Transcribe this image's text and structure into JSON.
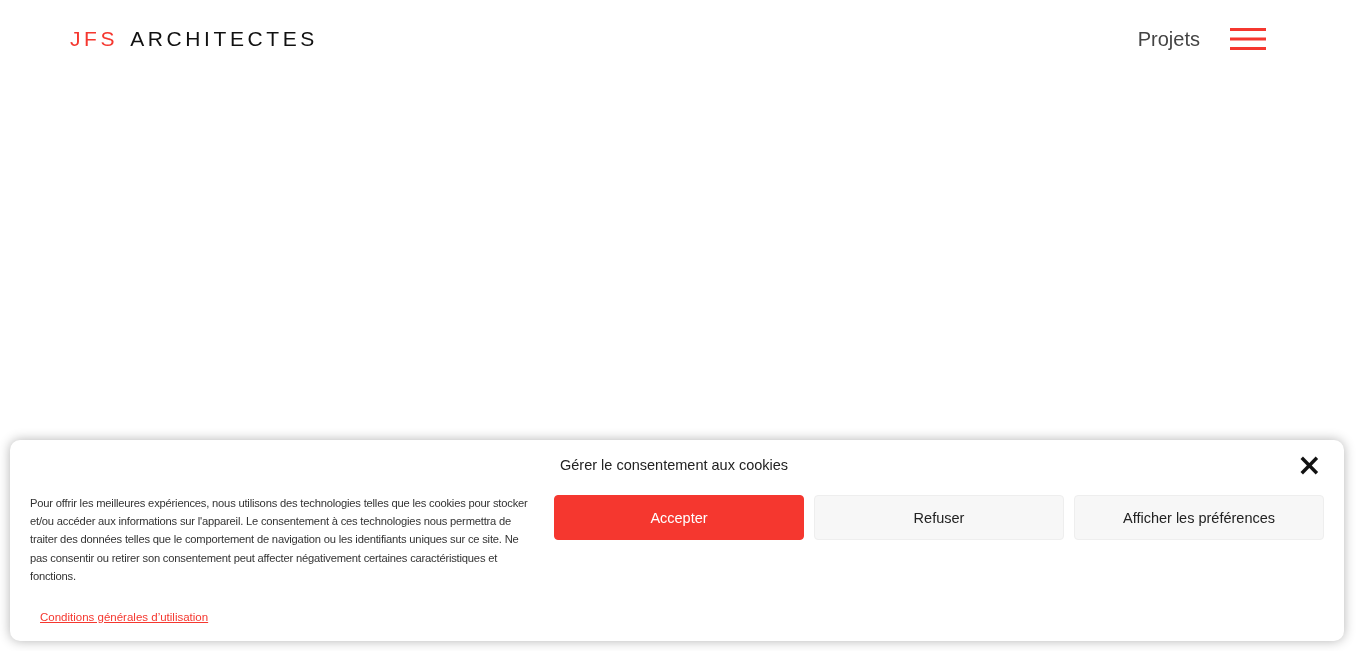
{
  "header": {
    "logo_accent": "JFS",
    "logo_text": "ARCHITECTES",
    "nav_link": "Projets"
  },
  "cookie_banner": {
    "title": "Gérer le consentement aux cookies",
    "close": "×",
    "message": "Pour offrir les meilleures expériences, nous utilisons des technologies telles que les cookies pour stocker et/ou accéder aux informations sur l'appareil. Le consentement à ces technologies nous permettra de traiter des données telles que le comportement de navigation ou les identifiants uniques sur ce site. Ne pas consentir ou retirer son consentement peut affecter négativement certaines caractéristiques et fonctions.",
    "buttons": [
      {
        "label": "Accepter",
        "kind": "primary"
      },
      {
        "label": "Refuser",
        "kind": "secondary"
      },
      {
        "label": "Afficher les préférences",
        "kind": "secondary"
      }
    ],
    "link": "Conditions générales d’utilisation"
  }
}
